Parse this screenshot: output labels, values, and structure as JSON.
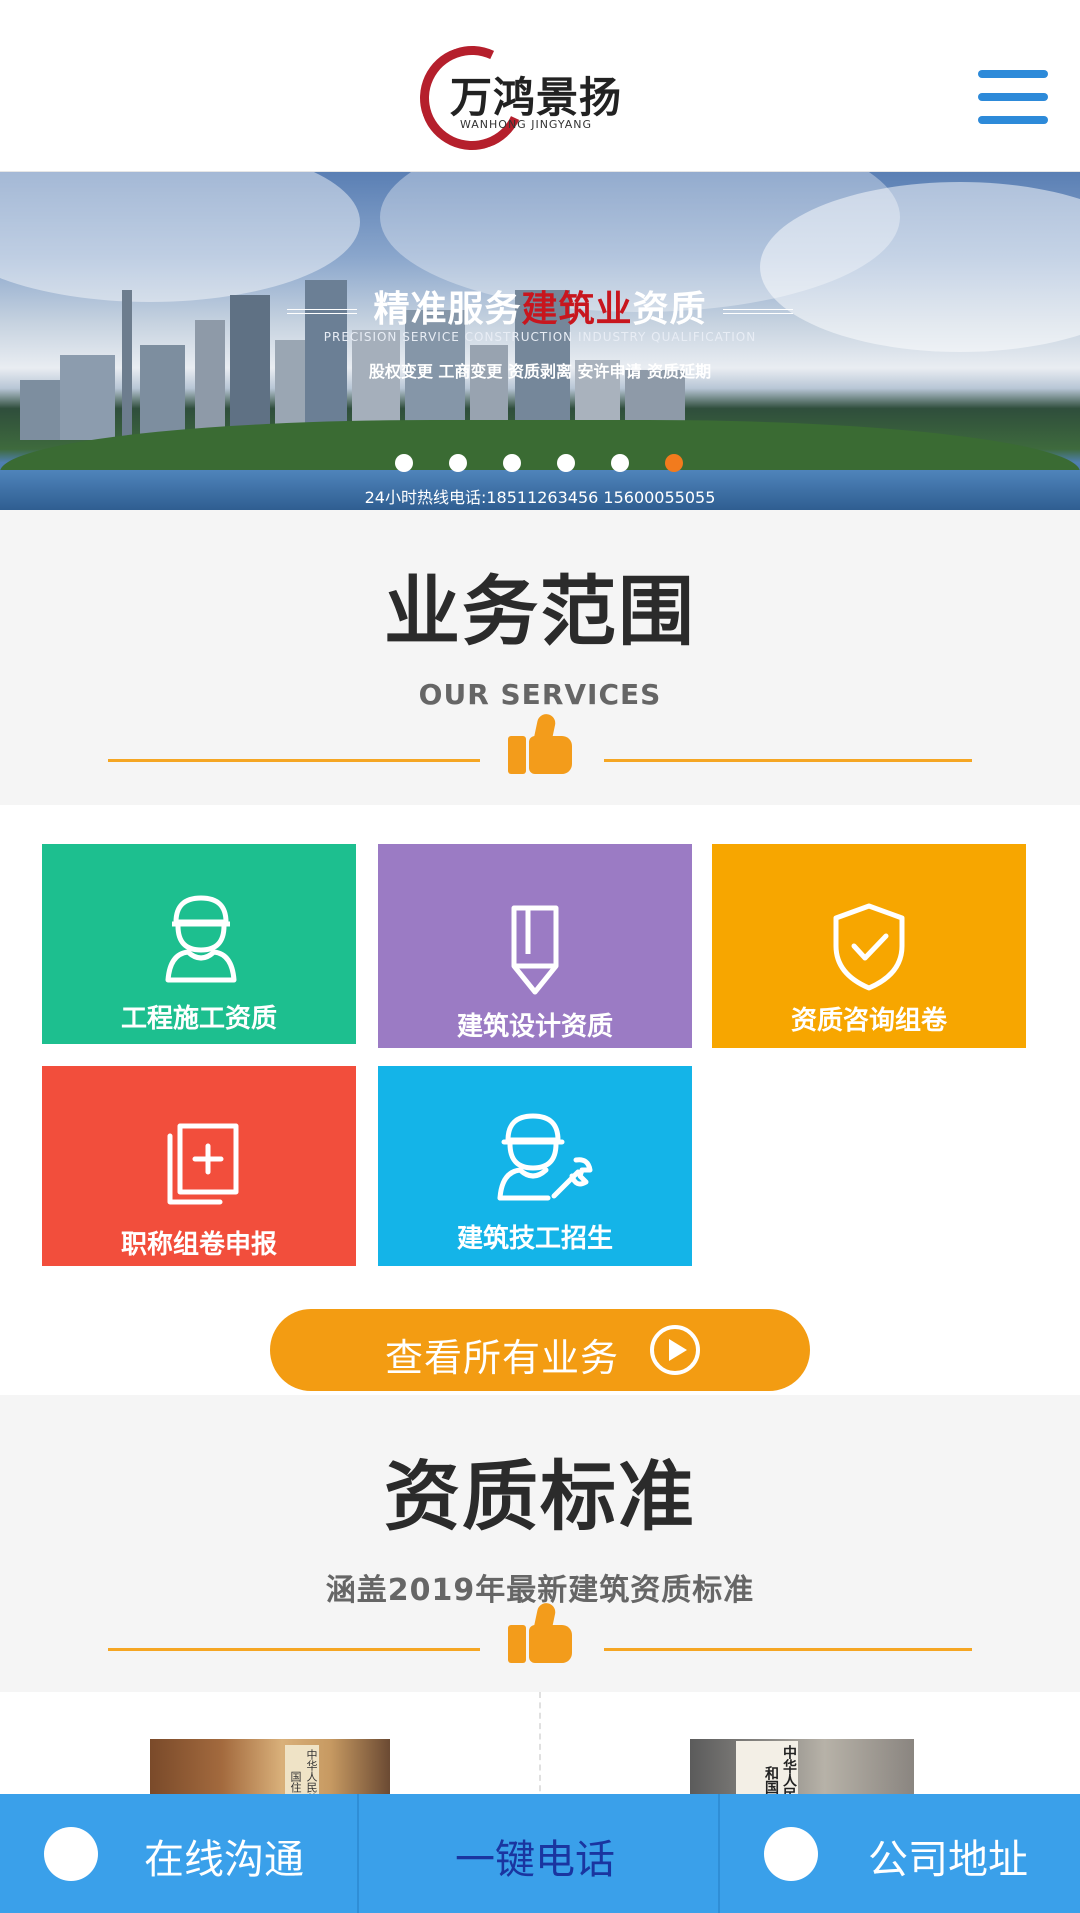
{
  "header": {
    "logo_name": "万鸿景扬",
    "logo_sub": "WANHONG JINGYANG"
  },
  "banner": {
    "title_part1": "精准服务",
    "title_highlight": "建筑业",
    "title_part2": "资质",
    "title_en": "PRECISION SERVICE CONSTRUCTION INDUSTRY QUALIFICATION",
    "services_line": "股权变更  工商变更  资质剥离  安许申请  资质延期",
    "hotline": "24小时热线电话:18511263456   15600055055",
    "slide_count": 6,
    "active_slide": 6,
    "active_color": "#f27b1d"
  },
  "services": {
    "title": "业务范围",
    "subtitle": "OUR SERVICES",
    "tiles": [
      {
        "label": "工程施工资质",
        "color": "#1dbf8f",
        "icon": "worker-helmet-icon"
      },
      {
        "label": "建筑设计资质",
        "color": "#9b7bc4",
        "icon": "pencil-icon"
      },
      {
        "label": "资质咨询组卷",
        "color": "#f7a600",
        "icon": "shield-check-icon"
      },
      {
        "label": "职称组卷申报",
        "color": "#f24e3c",
        "icon": "document-plus-icon"
      },
      {
        "label": "建筑技工招生",
        "color": "#14b4e8",
        "icon": "worker-wrench-icon"
      }
    ],
    "all_button": "查看所有业务"
  },
  "standards": {
    "title": "资质标准",
    "subtitle": "涵盖2019年最新建筑资质标准",
    "photo1_plate": "中华人民共和国住",
    "photo2_plate": "中华人民共和国"
  },
  "bottom_bar": {
    "chat": "在线沟通",
    "call": "一键电话",
    "address": "公司地址",
    "bg_color": "#3aa0ea"
  }
}
